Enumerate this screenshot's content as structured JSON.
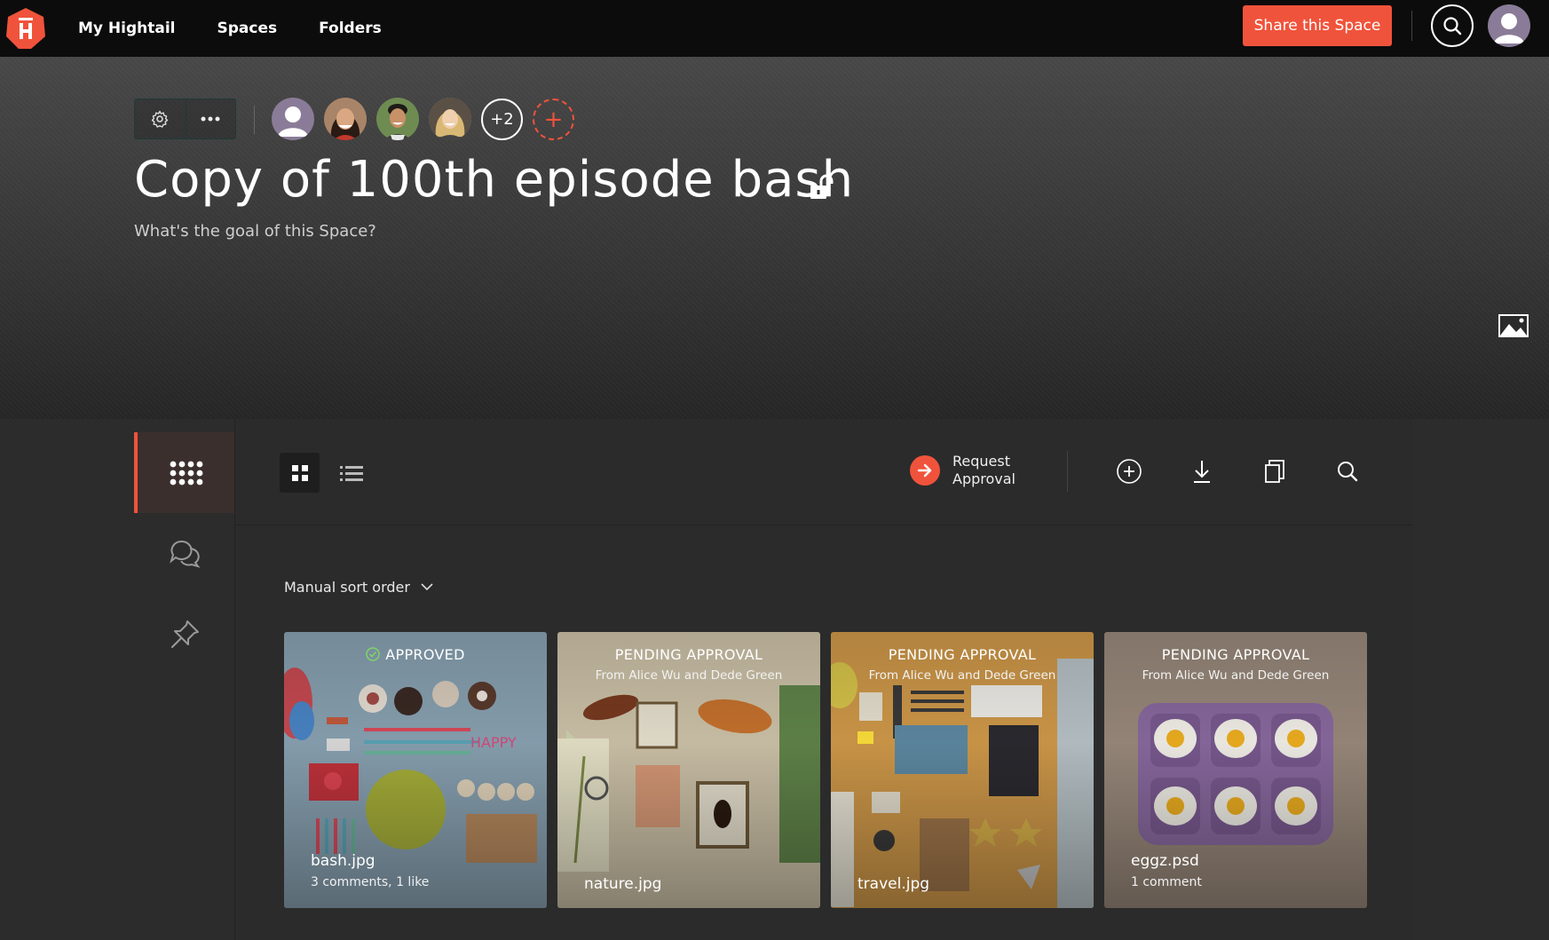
{
  "nav": {
    "items": [
      "My Hightail",
      "Spaces",
      "Folders"
    ]
  },
  "header": {
    "share_label": "Share this Space"
  },
  "space": {
    "title": "Copy of 100th episode bash",
    "subtitle": "What's the goal of this Space?",
    "extra_members": "+2",
    "add_member": "+"
  },
  "toolbar": {
    "request_approval": "Request Approval"
  },
  "sort": {
    "label": "Manual sort order"
  },
  "files": [
    {
      "status": "APPROVED",
      "from": "",
      "name": "bash.jpg",
      "meta": "3 comments, 1 like"
    },
    {
      "status": "PENDING APPROVAL",
      "from": "From Alice Wu and Dede Green",
      "name": "nature.jpg",
      "meta": ""
    },
    {
      "status": "PENDING APPROVAL",
      "from": "From Alice Wu and Dede Green",
      "name": "travel.jpg",
      "meta": ""
    },
    {
      "status": "PENDING APPROVAL",
      "from": "From Alice Wu and Dede Green",
      "name": "eggz.psd",
      "meta": "1 comment"
    }
  ],
  "colors": {
    "accent": "#f0533b",
    "topbar": "#0c0c0c",
    "panel": "#2b2b2b"
  },
  "icons": [
    "hightail-logo-icon",
    "search-icon",
    "user-avatar-icon",
    "gear-icon",
    "more-icon",
    "plus-icon",
    "unlock-icon",
    "image-icon",
    "grid-apps-icon",
    "chat-icon",
    "pin-icon",
    "grid-view-icon",
    "list-view-icon",
    "arrow-right-icon",
    "plus-circle-icon",
    "download-icon",
    "copy-icon",
    "check-circle-icon",
    "chevron-down-icon"
  ]
}
